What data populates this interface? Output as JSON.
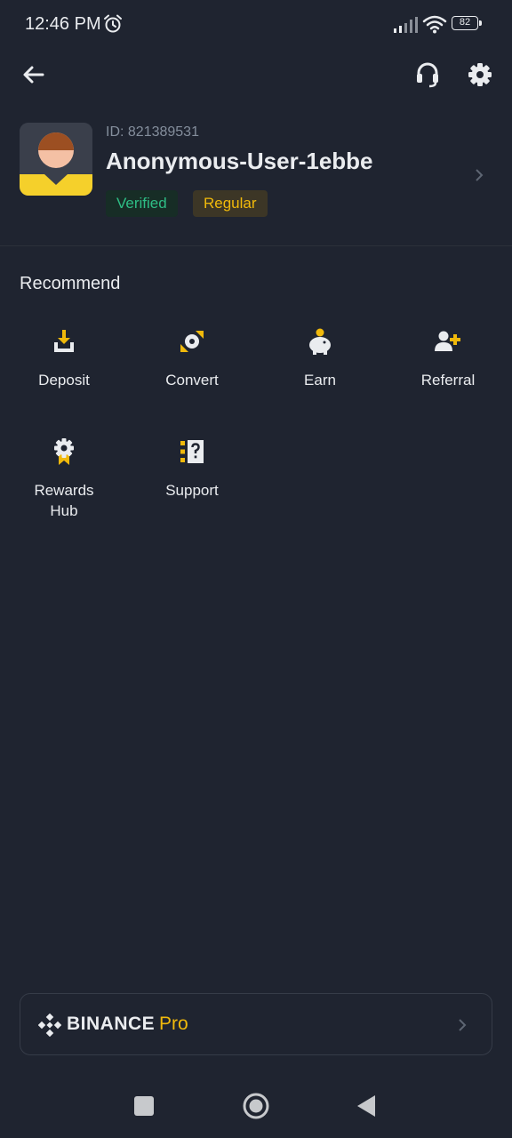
{
  "status_bar": {
    "time": "12:46 PM",
    "battery": "82"
  },
  "profile": {
    "id_label": "ID: 821389531",
    "name": "Anonymous-User-1ebbe",
    "badges": [
      "Verified",
      "Regular"
    ]
  },
  "recommend": {
    "title": "Recommend",
    "items": [
      {
        "label": "Deposit",
        "icon": "deposit-icon"
      },
      {
        "label": "Convert",
        "icon": "convert-icon"
      },
      {
        "label": "Earn",
        "icon": "piggy-bank-icon"
      },
      {
        "label": "Referral",
        "icon": "add-user-icon"
      },
      {
        "label": "Rewards Hub",
        "icon": "award-icon"
      },
      {
        "label": "Support",
        "icon": "support-doc-icon"
      }
    ]
  },
  "pro_card": {
    "brand": "BINANCE",
    "tag": "Pro"
  },
  "colors": {
    "background": "#1f2430",
    "accent_yellow": "#f0b90b",
    "verified_green": "#2ebd85",
    "text_primary": "#eaecef",
    "text_secondary": "#848e9c"
  }
}
